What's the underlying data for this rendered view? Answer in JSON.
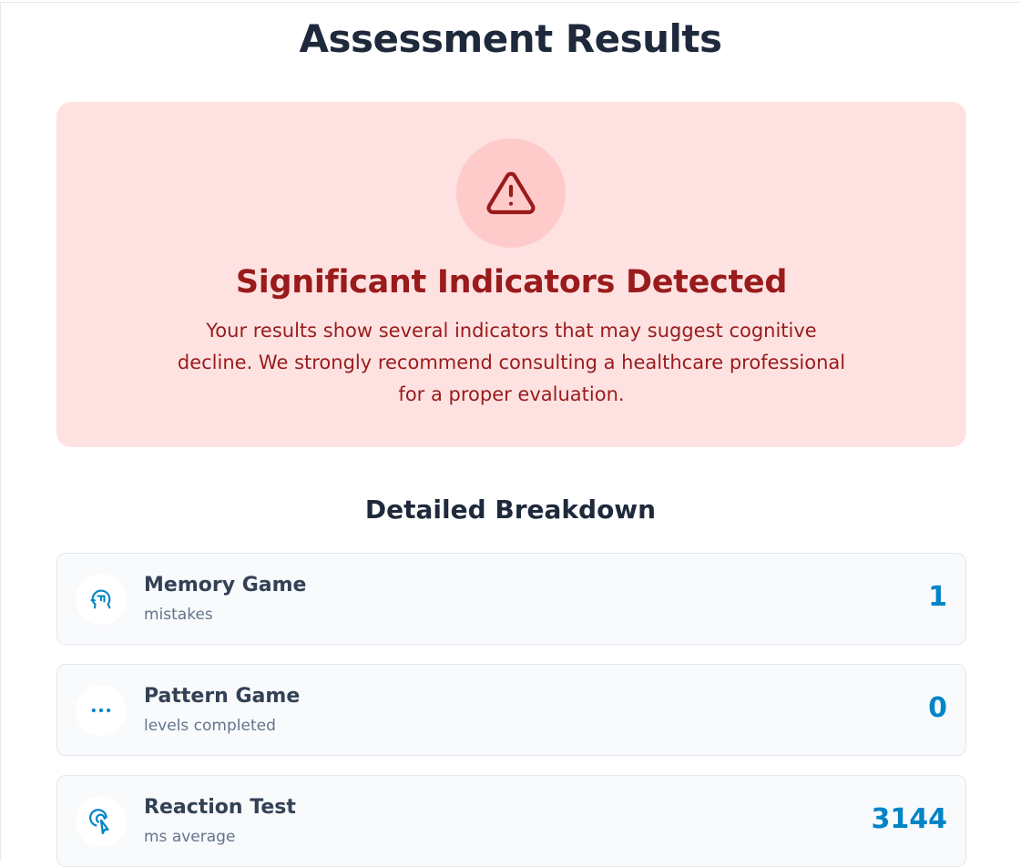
{
  "page": {
    "title": "Assessment Results"
  },
  "alert": {
    "icon": "warning-triangle-icon",
    "title": "Significant Indicators Detected",
    "message": "Your results show several indicators that may suggest cognitive decline. We strongly recommend consulting a healthcare professional for a proper evaluation.",
    "background_color": "#fee2e2",
    "text_color": "#991b1b"
  },
  "breakdown": {
    "title": "Detailed Breakdown",
    "value_color": "#0284c7",
    "items": [
      {
        "name": "Memory Game",
        "description": "mistakes",
        "value": "1",
        "icon": "brain-head-icon"
      },
      {
        "name": "Pattern Game",
        "description": "levels completed",
        "value": "0",
        "icon": "dots-icon"
      },
      {
        "name": "Reaction Test",
        "description": "ms average",
        "value": "3144",
        "icon": "tap-pointer-icon"
      }
    ]
  }
}
